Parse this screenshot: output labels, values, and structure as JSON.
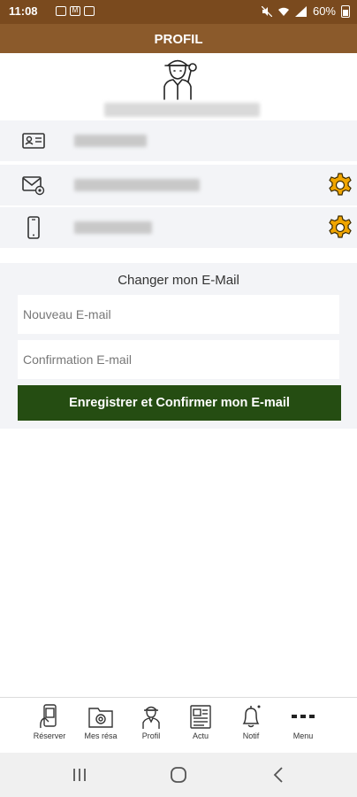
{
  "status_bar": {
    "time": "11:08",
    "battery": "60%"
  },
  "header": {
    "title": "PROFIL"
  },
  "profile": {
    "avatar_icon": "person-avatar-icon"
  },
  "info_rows": [
    {
      "icon": "id-card-icon",
      "value": "",
      "has_settings": false
    },
    {
      "icon": "email-icon",
      "value": "",
      "has_settings": true
    },
    {
      "icon": "phone-icon",
      "value": "",
      "has_settings": true
    }
  ],
  "email_form": {
    "title": "Changer mon E-Mail",
    "new_email_placeholder": "Nouveau E-mail",
    "confirm_email_placeholder": "Confirmation E-mail",
    "submit_label": "Enregistrer et Confirmer mon E-mail"
  },
  "nav": {
    "items": [
      {
        "label": "Réserver",
        "icon": "phone-booking-icon"
      },
      {
        "label": "Mes résa",
        "icon": "reservations-icon"
      },
      {
        "label": "Profil",
        "icon": "profile-icon"
      },
      {
        "label": "Actu",
        "icon": "newspaper-icon"
      },
      {
        "label": "Notif",
        "icon": "bell-icon"
      },
      {
        "label": "Menu",
        "icon": "more-dots-icon"
      }
    ]
  },
  "colors": {
    "header": "#8b5a2b",
    "status_bar": "#7a4a1e",
    "button": "#254d12",
    "gear": "#f0a500"
  }
}
